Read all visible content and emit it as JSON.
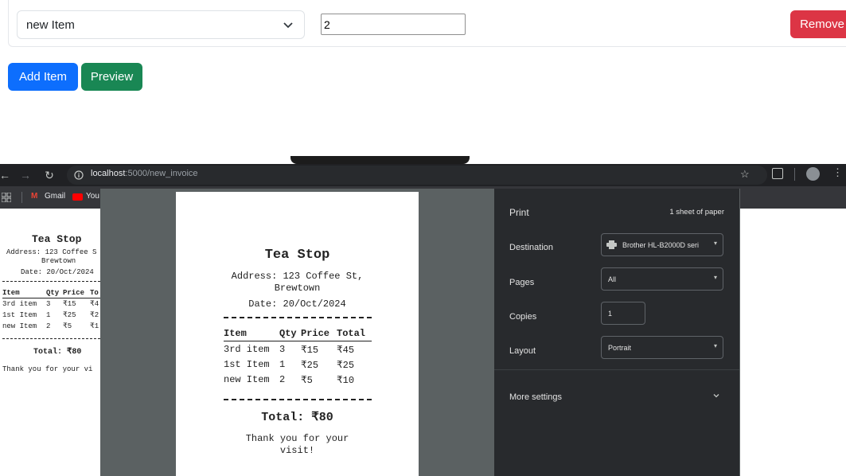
{
  "form": {
    "item_select_value": "new Item",
    "qty_value": "2",
    "remove_label": "Remove",
    "add_item_label": "Add Item",
    "preview_label": "Preview"
  },
  "browser": {
    "url_host": "localhost",
    "url_rest": ":5000/new_invoice",
    "bookmarks": [
      "Gmail",
      "You"
    ]
  },
  "receipt": {
    "shop": "Tea Stop",
    "address_line1": "Address: 123 Coffee St,",
    "address_line2": "Brewtown",
    "date": "Date: 20/Oct/2024",
    "headers": [
      "Item",
      "Qty",
      "Price",
      "Total"
    ],
    "rows": [
      [
        "3rd item",
        "3",
        "₹15",
        "₹45"
      ],
      [
        "1st Item",
        "1",
        "₹25",
        "₹25"
      ],
      [
        "new Item",
        "2",
        "₹5",
        "₹10"
      ]
    ],
    "total": "Total: ₹80",
    "thanks_line1": "Thank you for your",
    "thanks_line2": "visit!"
  },
  "background_receipt": {
    "shop": "Tea Stop",
    "address": "Address: 123 Coffee S",
    "address_line2": "Brewtown",
    "date": "Date: 20/Oct/2024",
    "headers": [
      "Item",
      "Qty",
      "Price",
      "To"
    ],
    "rows": [
      [
        "3rd item",
        "3",
        "₹15",
        "₹4"
      ],
      [
        "1st Item",
        "1",
        "₹25",
        "₹2"
      ],
      [
        "new Item",
        "2",
        "₹5",
        "₹1"
      ]
    ],
    "total": "Total: ₹80",
    "thanks": "Thank you for your vi"
  },
  "print_panel": {
    "title": "Print",
    "sheets": "1 sheet of paper",
    "destination_label": "Destination",
    "destination_value": "Brother HL-B2000D seri",
    "pages_label": "Pages",
    "pages_value": "All",
    "copies_label": "Copies",
    "copies_value": "1",
    "layout_label": "Layout",
    "layout_value": "Portrait",
    "more_settings_label": "More settings"
  },
  "colors": {
    "remove": "#dc3545",
    "add": "#0d6efd",
    "preview": "#198754"
  },
  "icons": [
    "chevron-down-icon",
    "back-arrow-icon",
    "forward-arrow-icon",
    "reload-icon",
    "info-icon",
    "star-icon",
    "extensions-icon",
    "profile-icon",
    "menu-icon",
    "apps-grid-icon",
    "gmail-icon",
    "youtube-icon",
    "printer-icon"
  ]
}
